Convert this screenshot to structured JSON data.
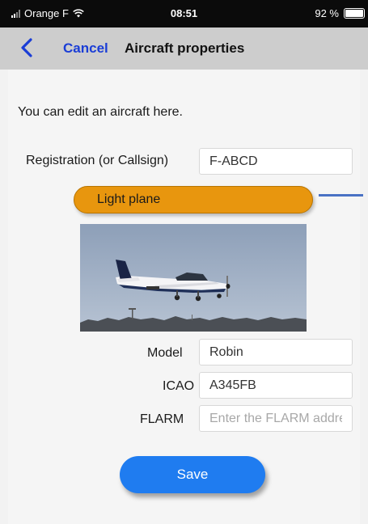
{
  "status_bar": {
    "carrier": "Orange F",
    "time": "08:51",
    "battery": "92 %",
    "icons": [
      "signal-icon",
      "wifi-icon",
      "battery-icon"
    ]
  },
  "nav": {
    "back_icon": "chevron-left-icon",
    "cancel_label": "Cancel",
    "title": "Aircraft properties"
  },
  "form": {
    "intro": "You can edit an aircraft here.",
    "registration": {
      "label": "Registration (or Callsign)",
      "value": "F-ABCD"
    },
    "aircraft_type": "Light plane",
    "model": {
      "label": "Model",
      "value": "Robin"
    },
    "icao": {
      "label": "ICAO",
      "value": "A345FB"
    },
    "flarm": {
      "label": "FLARM",
      "value": "",
      "placeholder": "Enter the FLARM address"
    },
    "save_label": "Save"
  },
  "colors": {
    "accent": "#1f7cf0",
    "cancel": "#1a3dd6",
    "type_pill": "#e8960e",
    "nav_bg": "#cdcdcd"
  }
}
